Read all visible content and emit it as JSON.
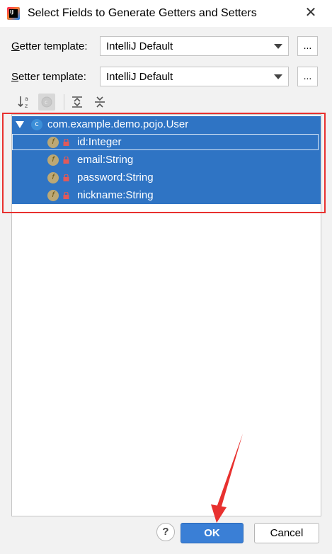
{
  "dialog": {
    "title": "Select Fields to Generate Getters and Setters"
  },
  "getter": {
    "label_mnemonic": "G",
    "label_rest": "etter template:",
    "value": "IntelliJ Default",
    "browse_label": "..."
  },
  "setter": {
    "label_mnemonic": "S",
    "label_rest": "etter template:",
    "value": "IntelliJ Default",
    "browse_label": "..."
  },
  "tree": {
    "class_node": {
      "icon": "class-icon",
      "glyph": "c",
      "label": "com.example.demo.pojo.User"
    },
    "fields": [
      {
        "label": "id:Integer",
        "glyph": "f"
      },
      {
        "label": "email:String",
        "glyph": "f"
      },
      {
        "label": "password:String",
        "glyph": "f"
      },
      {
        "label": "nickname:String",
        "glyph": "f"
      }
    ]
  },
  "footer": {
    "help_label": "?",
    "ok_label": "OK",
    "cancel_label": "Cancel"
  },
  "colors": {
    "selection": "#2f74c4",
    "highlight_border": "#e8312f",
    "ok_button": "#3a7fd6"
  }
}
